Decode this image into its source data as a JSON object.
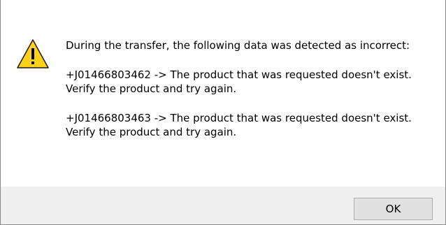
{
  "dialog": {
    "icon": "warning-icon",
    "paragraphs": [
      "During the transfer, the following data was detected as incorrect:",
      "+J01466803462 -> The product that was requested doesn't exist. Verify the product and try again.",
      "+J01466803463 -> The product that was requested doesn't exist. Verify the product and try again."
    ],
    "ok_label": "OK"
  },
  "colors": {
    "warning_fill": "#FCD116",
    "warning_stroke": "#000000",
    "footer_bg": "#F0F0F0",
    "button_bg": "#E1E1E1",
    "button_border": "#ADADAD"
  }
}
